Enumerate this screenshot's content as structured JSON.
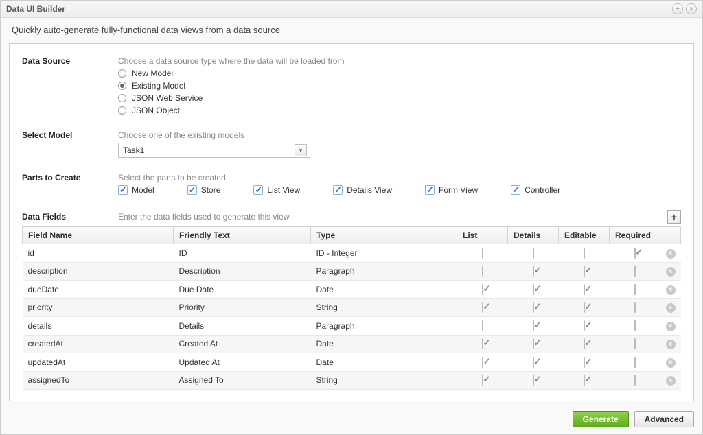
{
  "window": {
    "title": "Data UI Builder",
    "subtitle": "Quickly auto-generate fully-functional data views from a data source"
  },
  "sections": {
    "dataSource": {
      "label": "Data Source",
      "hint": "Choose a data source type where the data will be loaded from",
      "options": [
        {
          "label": "New Model",
          "checked": false
        },
        {
          "label": "Existing Model",
          "checked": true
        },
        {
          "label": "JSON Web Service",
          "checked": false
        },
        {
          "label": "JSON Object",
          "checked": false
        }
      ]
    },
    "selectModel": {
      "label": "Select Model",
      "hint": "Choose one of the existing models",
      "value": "Task1"
    },
    "parts": {
      "label": "Parts to Create",
      "hint": "Select the parts to be created.",
      "items": [
        {
          "label": "Model",
          "checked": true
        },
        {
          "label": "Store",
          "checked": true
        },
        {
          "label": "List View",
          "checked": true
        },
        {
          "label": "Details View",
          "checked": true
        },
        {
          "label": "Form View",
          "checked": true
        },
        {
          "label": "Controller",
          "checked": true
        }
      ]
    },
    "fields": {
      "label": "Data Fields",
      "hint": "Enter the data fields used to generate this view",
      "columns": {
        "fieldName": "Field Name",
        "friendly": "Friendly Text",
        "type": "Type",
        "list": "List",
        "details": "Details",
        "editable": "Editable",
        "required": "Required"
      },
      "rows": [
        {
          "fieldName": "id",
          "friendly": "ID",
          "type": "ID - Integer",
          "list": false,
          "details": false,
          "editable": false,
          "required": true
        },
        {
          "fieldName": "description",
          "friendly": "Description",
          "type": "Paragraph",
          "list": false,
          "details": true,
          "editable": true,
          "required": false
        },
        {
          "fieldName": "dueDate",
          "friendly": "Due Date",
          "type": "Date",
          "list": true,
          "details": true,
          "editable": true,
          "required": false
        },
        {
          "fieldName": "priority",
          "friendly": "Priority",
          "type": "String",
          "list": true,
          "details": true,
          "editable": true,
          "required": false
        },
        {
          "fieldName": "details",
          "friendly": "Details",
          "type": "Paragraph",
          "list": false,
          "details": true,
          "editable": true,
          "required": false
        },
        {
          "fieldName": "createdAt",
          "friendly": "Created At",
          "type": "Date",
          "list": true,
          "details": true,
          "editable": true,
          "required": false
        },
        {
          "fieldName": "updatedAt",
          "friendly": "Updated At",
          "type": "Date",
          "list": true,
          "details": true,
          "editable": true,
          "required": false
        },
        {
          "fieldName": "assignedTo",
          "friendly": "Assigned To",
          "type": "String",
          "list": true,
          "details": true,
          "editable": true,
          "required": false
        }
      ]
    }
  },
  "footer": {
    "generate": "Generate",
    "advanced": "Advanced"
  }
}
